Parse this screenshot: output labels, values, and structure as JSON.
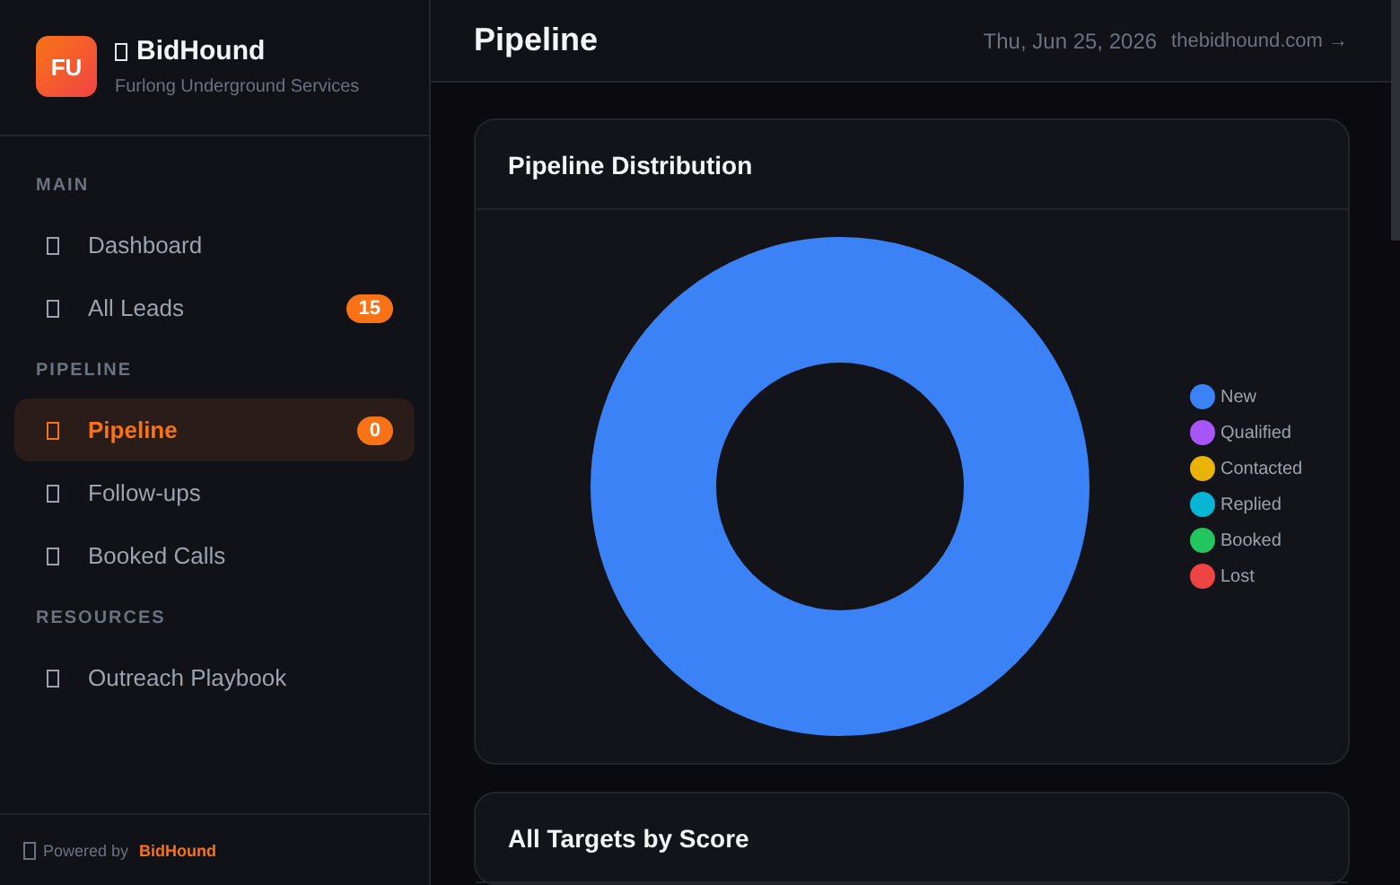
{
  "brand": {
    "initials": "FU",
    "name": "BidHound",
    "subtitle": "Furlong Underground Services"
  },
  "sidebar": {
    "sections": [
      {
        "title": "MAIN",
        "items": [
          {
            "label": "Dashboard",
            "selected": false
          },
          {
            "label": "All Leads",
            "selected": false,
            "badge": "15"
          }
        ]
      },
      {
        "title": "PIPELINE",
        "items": [
          {
            "label": "Pipeline",
            "selected": true,
            "badge": "0"
          },
          {
            "label": "Follow-ups",
            "selected": false
          },
          {
            "label": "Booked Calls",
            "selected": false
          }
        ]
      },
      {
        "title": "RESOURCES",
        "items": [
          {
            "label": "Outreach Playbook",
            "selected": false
          }
        ]
      }
    ]
  },
  "footer": {
    "prefix": "Powered by",
    "brand": "BidHound"
  },
  "header": {
    "title": "Pipeline",
    "date": "Thu, Jun 25, 2026",
    "link": "thebidhound.com →"
  },
  "distribution": {
    "title": "Pipeline Distribution",
    "legend": [
      {
        "label": "New",
        "color": "#3b82f6"
      },
      {
        "label": "Qualified",
        "color": "#a855f7"
      },
      {
        "label": "Contacted",
        "color": "#eab308"
      },
      {
        "label": "Replied",
        "color": "#06b6d4"
      },
      {
        "label": "Booked",
        "color": "#22c55e"
      },
      {
        "label": "Lost",
        "color": "#ef4444"
      }
    ]
  },
  "targets": {
    "title": "All Targets by Score"
  }
}
